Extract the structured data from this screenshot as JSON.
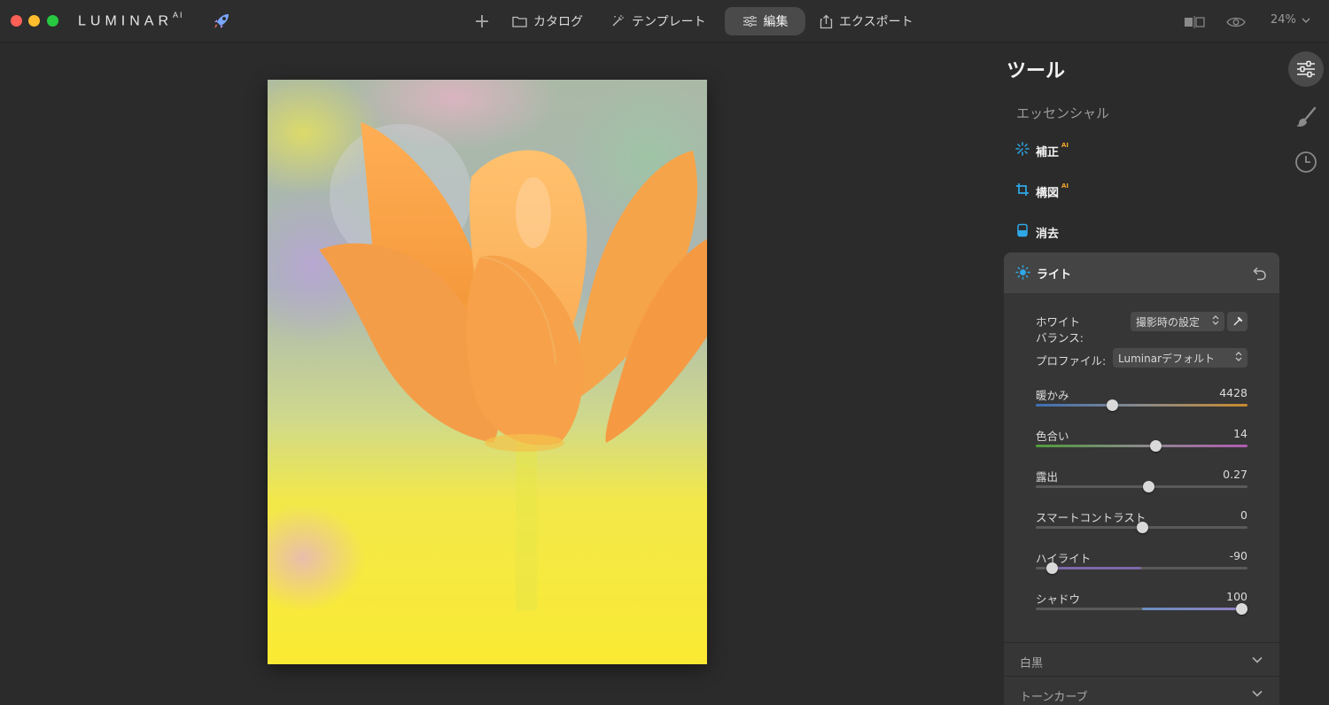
{
  "app": {
    "logo": "LUMINAR",
    "logo_sup": "AI"
  },
  "nav": {
    "catalog": "カタログ",
    "templates": "テンプレート",
    "edit": "編集",
    "export": "エクスポート"
  },
  "zoom": "24%",
  "tools": {
    "title": "ツール",
    "section": "エッセンシャル",
    "items": [
      {
        "label": "補正",
        "ai": "AI"
      },
      {
        "label": "構図",
        "ai": "AI"
      },
      {
        "label": "消去"
      }
    ]
  },
  "light": {
    "title": "ライト",
    "white_balance_label": "ホワイト\nバランス:",
    "white_balance_value": "撮影時の設定",
    "profile_label": "プロファイル:",
    "profile_value": "Luminarデフォルト",
    "sliders": [
      {
        "label": "暖かみ",
        "value": "4428",
        "position": 0.36
      },
      {
        "label": "色合い",
        "value": "14",
        "position": 0.565
      },
      {
        "label": "露出",
        "value": "0.27",
        "position": 0.53
      },
      {
        "label": "スマートコントラスト",
        "value": "0",
        "position": 0.5
      },
      {
        "label": "ハイライト",
        "value": "-90",
        "position": 0.075
      },
      {
        "label": "シャドウ",
        "value": "100",
        "position": 0.97
      }
    ]
  },
  "collapsed_sections": [
    "白黒",
    "トーンカーブ"
  ],
  "colors": {
    "accent_blue": "#2fa8e8",
    "ai_orange": "#f0a52a",
    "panel": "#363636",
    "background": "#2b2b2b"
  }
}
